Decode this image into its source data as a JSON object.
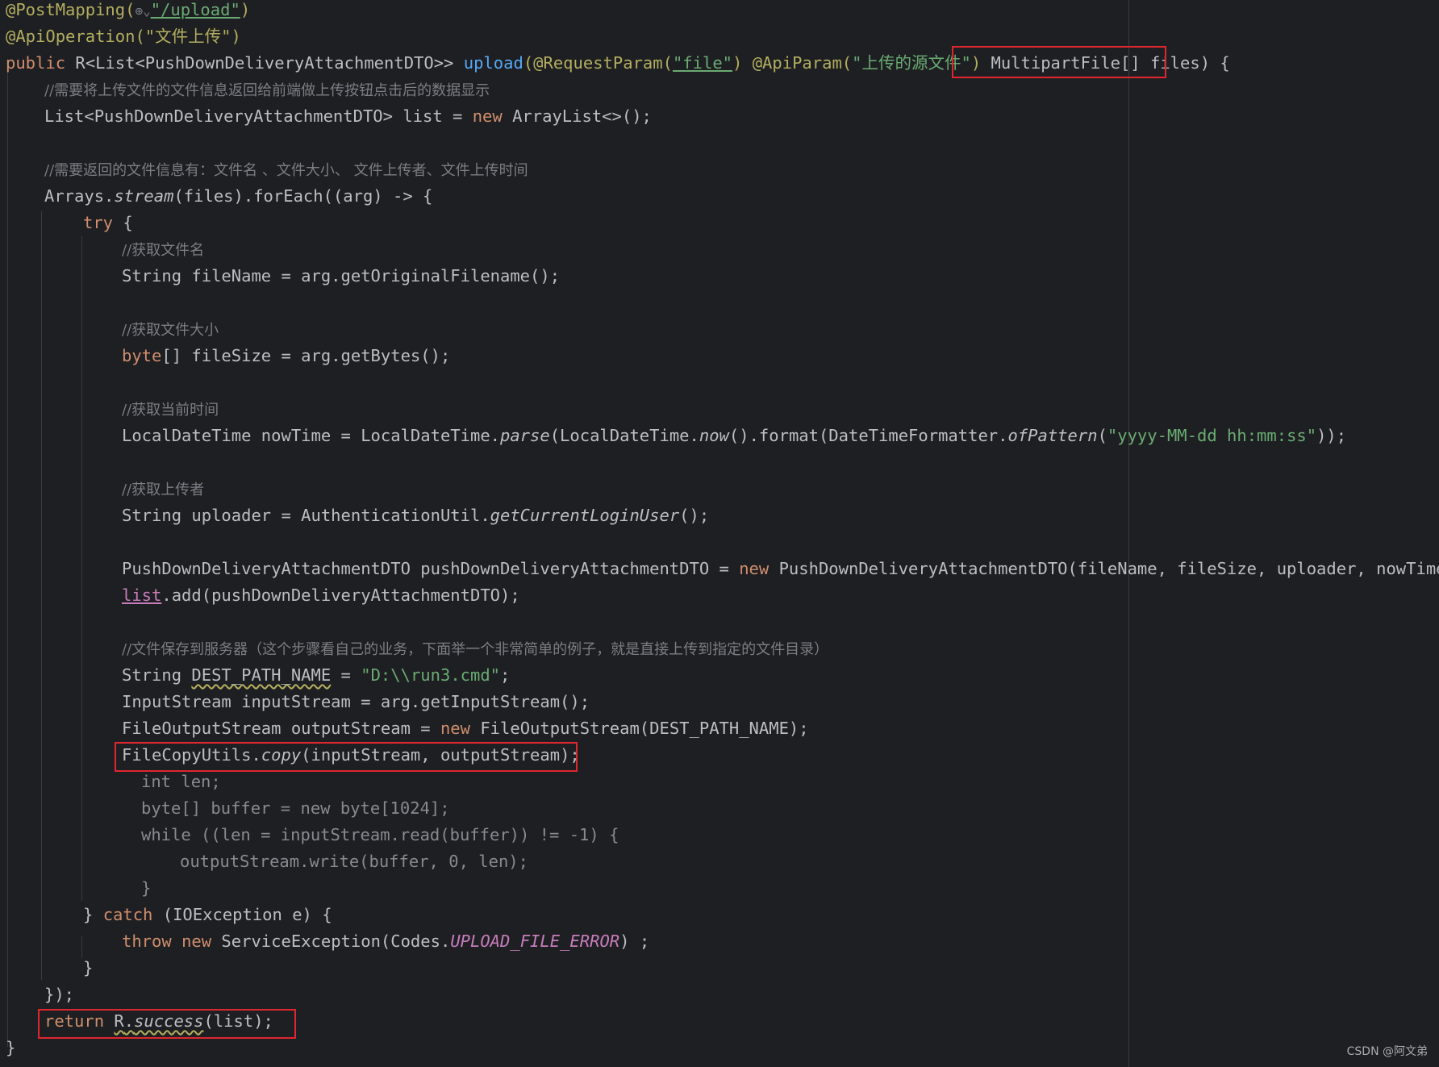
{
  "code": {
    "annotation1": "@PostMapping(",
    "globe_icon": "⊕⌄",
    "upload_path": "\"/upload\"",
    "annotation1_close": ")",
    "annotation2": "@ApiOperation(\"文件上传\")",
    "sig_public": "public ",
    "sig_return": "R<List<PushDownDeliveryAttachmentDTO>> ",
    "sig_method": "upload",
    "sig_anno1": "(@RequestParam(",
    "sig_str1": "\"file\"",
    "sig_anno2_pre": ") ",
    "sig_anno2": "@ApiParam(",
    "sig_str2": "\"上传的源文件\"",
    "sig_close": ") ",
    "sig_param": "MultipartFile[] files",
    "sig_end": ") {",
    "comment1": "//需要将上传文件的文件信息返回给前端做上传按钮点击后的数据显示",
    "line_list_decl_a": "List<PushDownDeliveryAttachmentDTO> list = ",
    "kw_new": "new",
    "line_list_decl_b": " ArrayList<>();",
    "comment2": "//需要返回的文件信息有：文件名 、文件大小、 文件上传者、文件上传时间",
    "arrays_a": "Arrays.",
    "arrays_stream": "stream",
    "arrays_b": "(files).forEach((arg) -> {",
    "kw_try": "try",
    "try_brace": " {",
    "comment3": "//获取文件名",
    "line_filename": "String fileName = arg.getOriginalFilename();",
    "comment4": "//获取文件大小",
    "kw_byte": "byte",
    "line_filesize": "[] fileSize = arg.getBytes();",
    "comment5": "//获取当前时间",
    "now_a": "LocalDateTime nowTime = LocalDateTime.",
    "now_parse": "parse",
    "now_b": "(LocalDateTime.",
    "now_now": "now",
    "now_c": "().format(DateTimeFormatter.",
    "now_ofpattern": "ofPattern",
    "now_d": "(",
    "now_str": "\"yyyy-MM-dd hh:mm:ss\"",
    "now_e": "));",
    "comment6": "//获取上传者",
    "uploader_a": "String uploader = AuthenticationUtil.",
    "uploader_method": "getCurrentLoginUser",
    "uploader_b": "();",
    "dto_a": "PushDownDeliveryAttachmentDTO pushDownDeliveryAttachmentDTO = ",
    "dto_b": " PushDownDeliveryAttachmentDTO(fileName, fileSize, uploader, nowTime);",
    "list_ref": "list",
    "list_add": ".add(pushDownDeliveryAttachmentDTO);",
    "comment7": "//文件保存到服务器（这个步骤看自己的业务，下面举一个非常简单的例子，就是直接上传到指定的文件目录）",
    "dest_a": "String ",
    "dest_name": "DEST_PATH_NAME",
    "dest_b": " = ",
    "dest_str": "\"D:\\\\run3.cmd\"",
    "dest_c": ";",
    "input_stream": "InputStream inputStream = arg.getInputStream();",
    "fos_a": "FileOutputStream outputStream = ",
    "fos_b": " FileOutputStream(DEST_PATH_NAME);",
    "copy_a": "FileCopyUtils.",
    "copy_method": "copy",
    "copy_b": "(inputStream, outputStream);",
    "folded1": "int len;",
    "folded2": "byte[] buffer = new byte[1024];",
    "folded3": "while ((len = inputStream.read(buffer)) != -1) {",
    "folded4": "outputStream.write(buffer, 0, len);",
    "folded5": "}",
    "catch_a": "} ",
    "kw_catch": "catch",
    "catch_b": " (IOException e) {",
    "kw_throw": "throw",
    "throw_sp": " ",
    "throw_b": " ServiceException(Codes.",
    "throw_const": "UPLOAD_FILE_ERROR",
    "throw_c": ") ;",
    "close_try": "}",
    "close_lambda": "});",
    "kw_return": "return",
    "return_sp": " ",
    "return_r": "R",
    "return_dot": ".",
    "return_success": "success",
    "return_b": "(list);",
    "close_method": "}"
  },
  "watermark": "CSDN @阿文弟",
  "colors": {
    "background": "#1e1f22",
    "text": "#bcbec4",
    "keyword": "#cf8e6d",
    "annotation": "#b3ae60",
    "string": "#6aab73",
    "method": "#56a8f5",
    "comment": "#7a7e85",
    "constant": "#c77dbb",
    "highlight_box": "#e0262e"
  }
}
